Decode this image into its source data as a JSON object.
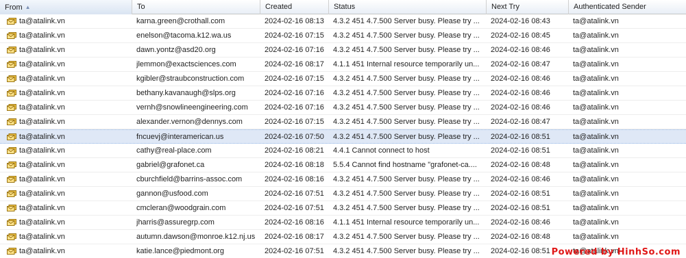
{
  "columns": [
    {
      "label": "From"
    },
    {
      "label": "To"
    },
    {
      "label": "Created"
    },
    {
      "label": "Status"
    },
    {
      "label": "Next Try"
    },
    {
      "label": "Authenticated Sender"
    }
  ],
  "sort": {
    "column": "From",
    "direction": "ascending",
    "icon": "sort-ascending-icon"
  },
  "row_icon": "mail-envelope-icon",
  "selected_row_index": 8,
  "rows": [
    {
      "from": "ta@atalink.vn",
      "to": "karna.green@crothall.com",
      "created": "2024-02-16 08:13",
      "status": "4.3.2 451 4.7.500 Server busy. Please try ...",
      "next_try": "2024-02-16 08:43",
      "auth_sender": "ta@atalink.vn"
    },
    {
      "from": "ta@atalink.vn",
      "to": "enelson@tacoma.k12.wa.us",
      "created": "2024-02-16 07:15",
      "status": "4.3.2 451 4.7.500 Server busy. Please try ...",
      "next_try": "2024-02-16 08:45",
      "auth_sender": "ta@atalink.vn"
    },
    {
      "from": "ta@atalink.vn",
      "to": "dawn.yontz@asd20.org",
      "created": "2024-02-16 07:16",
      "status": "4.3.2 451 4.7.500 Server busy. Please try ...",
      "next_try": "2024-02-16 08:46",
      "auth_sender": "ta@atalink.vn"
    },
    {
      "from": "ta@atalink.vn",
      "to": "jlemmon@exactsciences.com",
      "created": "2024-02-16 08:17",
      "status": "4.1.1 451 Internal resource temporarily un...",
      "next_try": "2024-02-16 08:47",
      "auth_sender": "ta@atalink.vn"
    },
    {
      "from": "ta@atalink.vn",
      "to": "kgibler@straubconstruction.com",
      "created": "2024-02-16 07:15",
      "status": "4.3.2 451 4.7.500 Server busy. Please try ...",
      "next_try": "2024-02-16 08:46",
      "auth_sender": "ta@atalink.vn"
    },
    {
      "from": "ta@atalink.vn",
      "to": "bethany.kavanaugh@slps.org",
      "created": "2024-02-16 07:16",
      "status": "4.3.2 451 4.7.500 Server busy. Please try ...",
      "next_try": "2024-02-16 08:46",
      "auth_sender": "ta@atalink.vn"
    },
    {
      "from": "ta@atalink.vn",
      "to": "vernh@snowlineengineering.com",
      "created": "2024-02-16 07:16",
      "status": "4.3.2 451 4.7.500 Server busy. Please try ...",
      "next_try": "2024-02-16 08:46",
      "auth_sender": "ta@atalink.vn"
    },
    {
      "from": "ta@atalink.vn",
      "to": "alexander.vernon@dennys.com",
      "created": "2024-02-16 07:15",
      "status": "4.3.2 451 4.7.500 Server busy. Please try ...",
      "next_try": "2024-02-16 08:47",
      "auth_sender": "ta@atalink.vn"
    },
    {
      "from": "ta@atalink.vn",
      "to": "fncuevj@interamerican.us",
      "created": "2024-02-16 07:50",
      "status": "4.3.2 451 4.7.500 Server busy. Please try ...",
      "next_try": "2024-02-16 08:51",
      "auth_sender": "ta@atalink.vn"
    },
    {
      "from": "ta@atalink.vn",
      "to": "cathy@real-place.com",
      "created": "2024-02-16 08:21",
      "status": "4.4.1 Cannot connect to host",
      "next_try": "2024-02-16 08:51",
      "auth_sender": "ta@atalink.vn"
    },
    {
      "from": "ta@atalink.vn",
      "to": "gabriel@grafonet.ca",
      "created": "2024-02-16 08:18",
      "status": "5.5.4 Cannot find hostname \"grafonet-ca....",
      "next_try": "2024-02-16 08:48",
      "auth_sender": "ta@atalink.vn"
    },
    {
      "from": "ta@atalink.vn",
      "to": "cburchfield@barrins-assoc.com",
      "created": "2024-02-16 08:16",
      "status": "4.3.2 451 4.7.500 Server busy. Please try ...",
      "next_try": "2024-02-16 08:46",
      "auth_sender": "ta@atalink.vn"
    },
    {
      "from": "ta@atalink.vn",
      "to": "gannon@usfood.com",
      "created": "2024-02-16 07:51",
      "status": "4.3.2 451 4.7.500 Server busy. Please try ...",
      "next_try": "2024-02-16 08:51",
      "auth_sender": "ta@atalink.vn"
    },
    {
      "from": "ta@atalink.vn",
      "to": "cmcleran@woodgrain.com",
      "created": "2024-02-16 07:51",
      "status": "4.3.2 451 4.7.500 Server busy. Please try ...",
      "next_try": "2024-02-16 08:51",
      "auth_sender": "ta@atalink.vn"
    },
    {
      "from": "ta@atalink.vn",
      "to": "jharris@assuregrp.com",
      "created": "2024-02-16 08:16",
      "status": "4.1.1 451 Internal resource temporarily un...",
      "next_try": "2024-02-16 08:46",
      "auth_sender": "ta@atalink.vn"
    },
    {
      "from": "ta@atalink.vn",
      "to": "autumn.dawson@monroe.k12.nj.us",
      "created": "2024-02-16 08:17",
      "status": "4.3.2 451 4.7.500 Server busy. Please try ...",
      "next_try": "2024-02-16 08:48",
      "auth_sender": "ta@atalink.vn"
    },
    {
      "from": "ta@atalink.vn",
      "to": "katie.lance@piedmont.org",
      "created": "2024-02-16 07:51",
      "status": "4.3.2 451 4.7.500 Server busy. Please try ...",
      "next_try": "2024-02-16 08:51",
      "auth_sender": "ta@atalink.vn"
    }
  ],
  "watermark": {
    "text": "Powered by HinhSo.com"
  }
}
